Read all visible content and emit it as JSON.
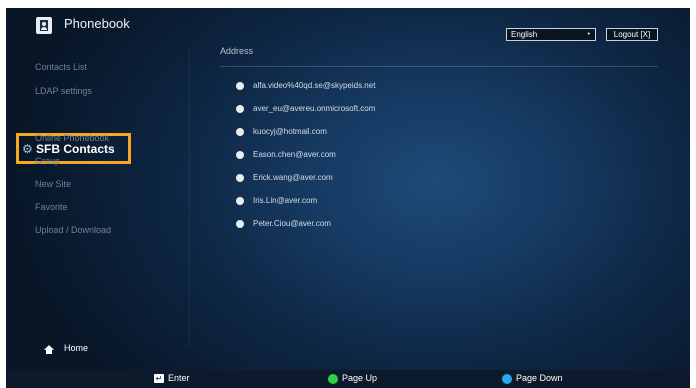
{
  "app": {
    "title": "Phonebook",
    "icon": "phonebook-icon"
  },
  "header": {
    "language": "English",
    "logout_label": "Logout [X]"
  },
  "sidebar": {
    "items": [
      {
        "label": "Contacts List"
      },
      {
        "label": "LDAP settings"
      },
      {
        "label": "SFB Contacts",
        "active": true,
        "icon": "gear-icon"
      },
      {
        "label": "Online Phonebook"
      },
      {
        "label": "Group"
      },
      {
        "label": "New Site"
      },
      {
        "label": "Favorite"
      },
      {
        "label": "Upload / Download"
      }
    ],
    "home_label": "Home",
    "home_icon": "home-icon",
    "active_highlight_color": "#f5a623"
  },
  "main": {
    "column_header": "Address",
    "contacts": [
      "alfa.video%40qd.se@skypeids.net",
      "aver_eu@avereu.onmicrosoft.com",
      "kuocyj@hotmail.com",
      "Eason.chen@aver.com",
      "Erick.wang@aver.com",
      "Iris.Lin@aver.com",
      "Peter.Ciou@aver.com"
    ]
  },
  "footer": {
    "enter_label": "Enter",
    "page_up_label": "Page Up",
    "page_down_label": "Page Down",
    "page_up_color": "#2fcf4a",
    "page_down_color": "#29a8f0"
  }
}
